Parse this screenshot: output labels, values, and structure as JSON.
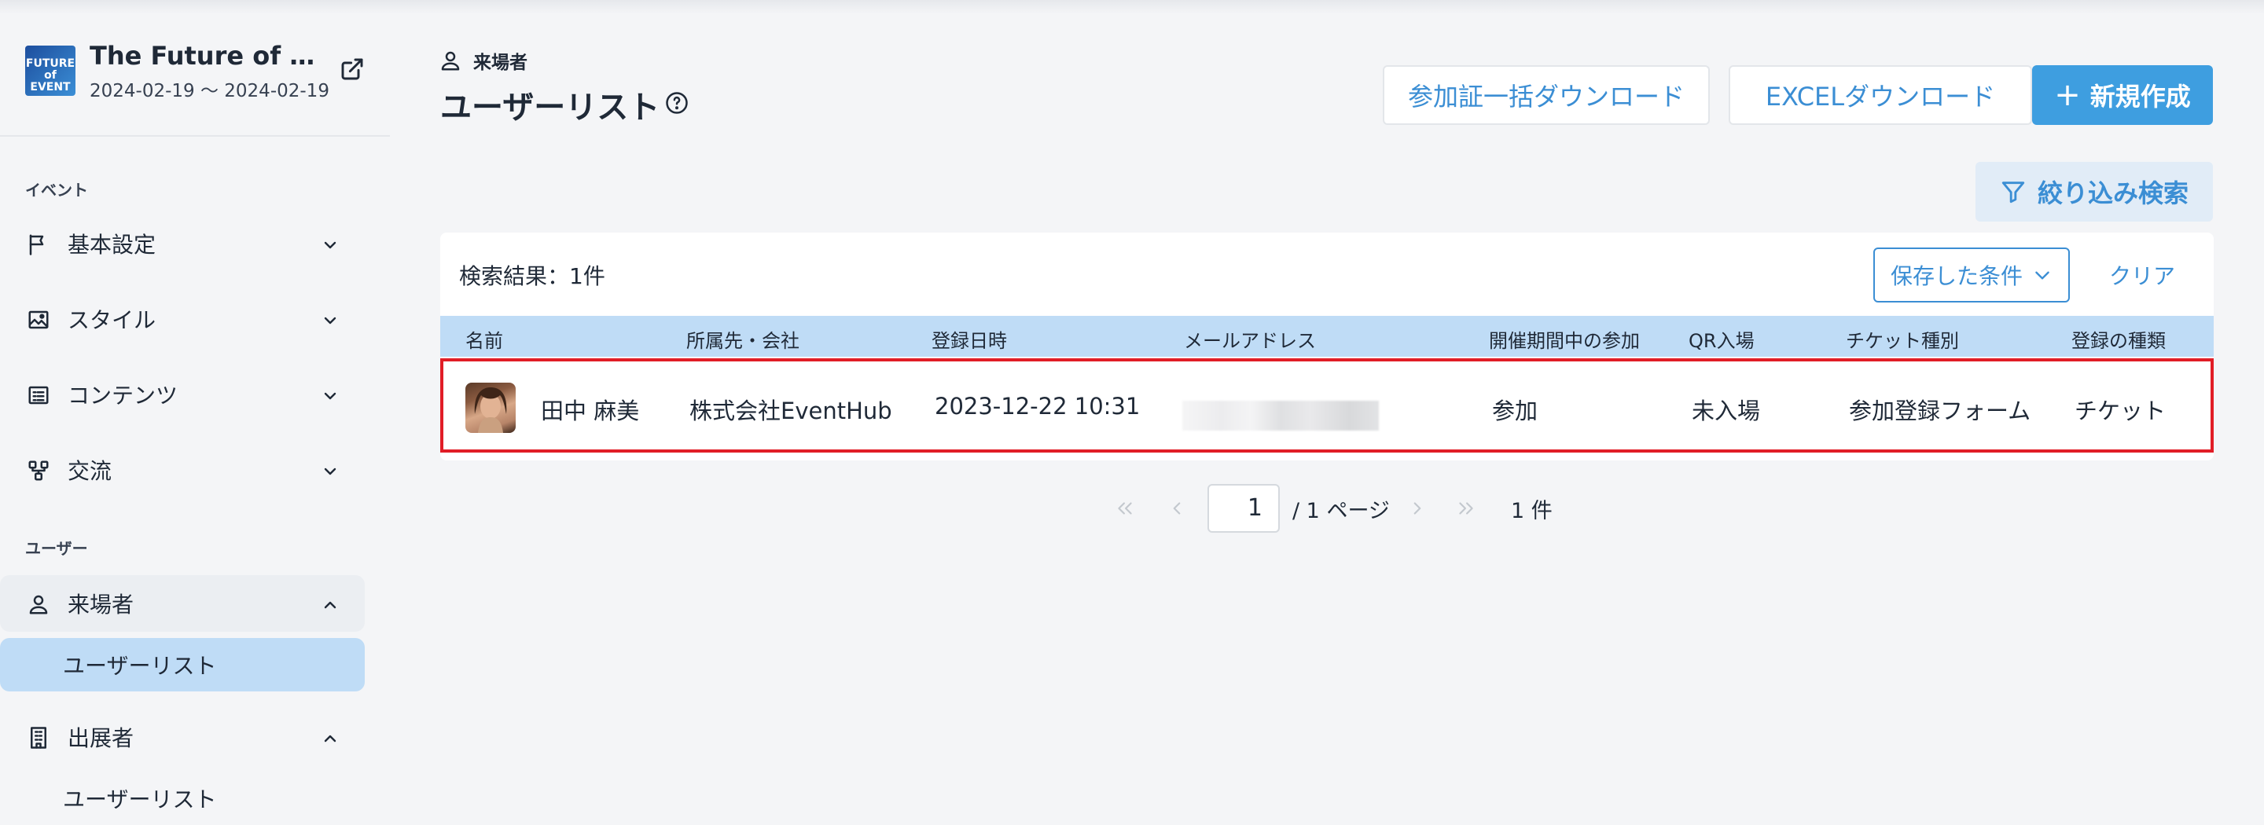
{
  "event": {
    "title": "The Future of Eve…",
    "dates": "2024-02-19 ～ 2024-02-19",
    "logo_text": "FUTURE of EVENT"
  },
  "sidebar": {
    "sections": [
      {
        "label": "イベント"
      },
      {
        "label": "ユーザー"
      }
    ],
    "items": [
      {
        "label": "基本設定",
        "icon": "flag-icon"
      },
      {
        "label": "スタイル",
        "icon": "image-icon"
      },
      {
        "label": "コンテンツ",
        "icon": "list-icon"
      },
      {
        "label": "交流",
        "icon": "network-icon"
      },
      {
        "label": "来場者",
        "icon": "person-icon"
      },
      {
        "label": "出展者",
        "icon": "building-icon"
      }
    ],
    "sub_items": [
      {
        "label": "ユーザーリスト"
      },
      {
        "label": "ユーザーリスト"
      }
    ]
  },
  "header": {
    "breadcrumb": "来場者",
    "title": "ユーザーリスト"
  },
  "toolbar": {
    "badge_download": "参加証一括ダウンロード",
    "excel_download": "EXCELダウンロード",
    "create_new": "新規作成",
    "filter_search": "絞り込み検索"
  },
  "results": {
    "count_label": "検索結果：1件",
    "saved_conditions": "保存した条件",
    "clear": "クリア"
  },
  "table": {
    "columns": [
      "名前",
      "所属先・会社",
      "登録日時",
      "メールアドレス",
      "開催期間中の参加",
      "QR入場",
      "チケット種別",
      "登録の種類"
    ],
    "rows": [
      {
        "name": "田中 麻美",
        "company": "株式会社EventHub",
        "registered_at": "2023-12-22 10:31",
        "email": "",
        "participation": "参加",
        "qr_entry": "未入場",
        "ticket_type": "参加登録フォーム",
        "registration_type": "チケット"
      }
    ]
  },
  "pagination": {
    "current_page": "1",
    "total_pages": "/ 1 ページ",
    "total_count": "1 件"
  },
  "colors": {
    "accent": "#3e9ee0",
    "accent_text": "#3b8ed4",
    "table_header": "#bfdcf6",
    "highlight_border": "#e11d26",
    "active_nav": "#bfdcf6"
  }
}
